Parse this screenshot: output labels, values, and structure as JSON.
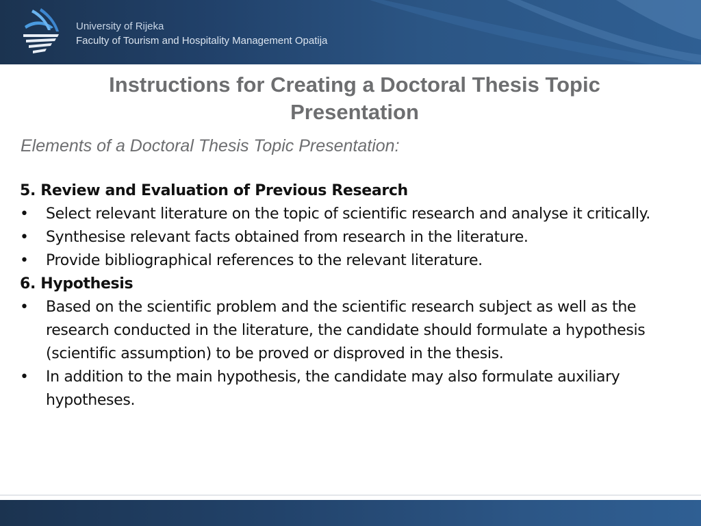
{
  "header": {
    "university": "University of Rijeka",
    "faculty": "Faculty of Tourism and Hospitality Management Opatija",
    "logo_icon": "faculty-logo-icon"
  },
  "slide": {
    "title_line1": "Instructions for Creating a Doctoral Thesis Topic",
    "title_line2": "Presentation",
    "subtitle": "Elements of a Doctoral Thesis Topic Presentation:"
  },
  "sections": [
    {
      "heading": "5. Review and Evaluation of Previous Research",
      "bullets": [
        "Select relevant literature on the topic of scientific research and analyse it critically.",
        "Synthesise relevant facts obtained from research in the literature.",
        "Provide bibliographical references to the relevant literature."
      ]
    },
    {
      "heading": "6. Hypothesis",
      "bullets": [
        "Based on the scientific problem and the scientific research subject as well as the research conducted in the literature, the candidate should formulate a hypothesis (scientific assumption) to be proved or disproved in the thesis.",
        "In addition to the main hypothesis, the candidate may also formulate auxiliary hypotheses."
      ]
    }
  ],
  "bullet_glyph": "•",
  "colors": {
    "header_dark": "#1b3350",
    "header_light": "#2f5f93",
    "title_gray": "#6d6e70",
    "body_text": "#111111"
  }
}
